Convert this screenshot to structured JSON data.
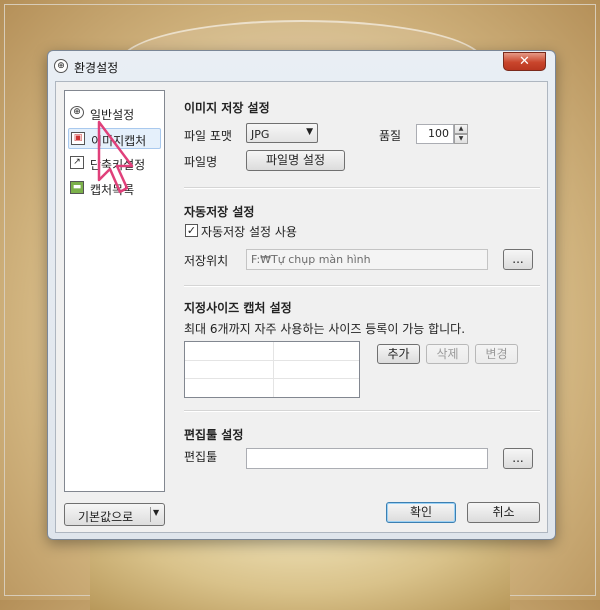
{
  "window": {
    "title": "환경설정",
    "close_label": "✕"
  },
  "nav": {
    "items": [
      {
        "label": "일반설정",
        "icon": "general-settings-icon",
        "selected": false
      },
      {
        "label": "이미지캡처",
        "icon": "image-capture-icon",
        "selected": true
      },
      {
        "label": "단축키설정",
        "icon": "shortcut-icon",
        "selected": false
      },
      {
        "label": "캡처목록",
        "icon": "capture-list-icon",
        "selected": false
      }
    ]
  },
  "image_settings": {
    "title": "이미지 저장 설정",
    "format_label": "파일 포맷",
    "format_value": "JPG",
    "quality_label": "품질",
    "quality_value": "100",
    "filename_label": "파일명",
    "filename_button": "파일명 설정"
  },
  "autosave": {
    "title": "자동저장 설정",
    "checkbox_label": "자동저장 설정 사용",
    "checked": true,
    "location_label": "저장위치",
    "location_value": "F:₩Tự chụp màn hình",
    "browse_label": "..."
  },
  "size_capture": {
    "title": "지정사이즈 캡처 설정",
    "description": "최대 6개까지 자주 사용하는 사이즈 등록이 가능 합니다.",
    "add_label": "추가",
    "delete_label": "삭제",
    "edit_label": "변경"
  },
  "editor": {
    "title": "편집툴 설정",
    "editor_label": "편집툴",
    "editor_value": "",
    "browse_label": "..."
  },
  "footer": {
    "reset_label": "기본값으로",
    "ok_label": "확인",
    "cancel_label": "취소"
  },
  "colors": {
    "accent_close": "#c9452c",
    "selection": "#e5f0fb",
    "cursor": "#e0407a"
  }
}
